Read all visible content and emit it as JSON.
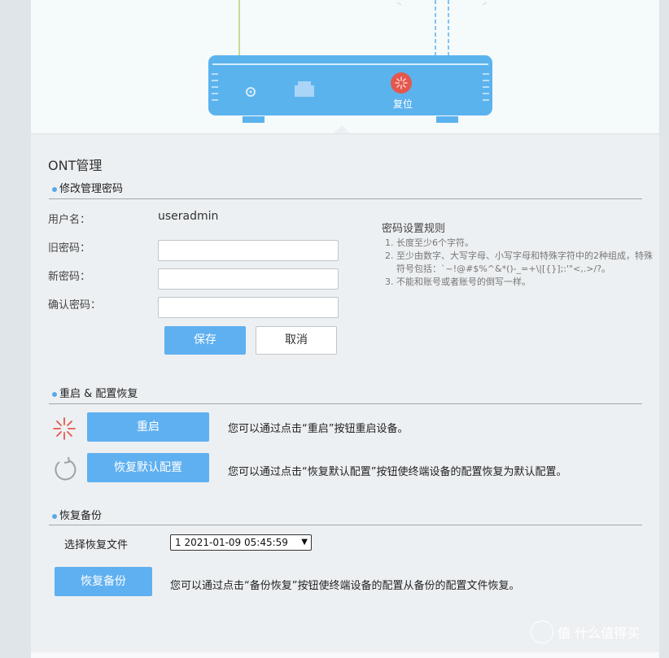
{
  "router": {
    "reset_label": "复位"
  },
  "page": {
    "title": "ONT管理"
  },
  "password_section": {
    "title": "修改管理密码",
    "username_label": "用户名：",
    "username_value": "useradmin",
    "old_password_label": "旧密码：",
    "new_password_label": "新密码：",
    "confirm_password_label": "确认密码：",
    "save_label": "保存",
    "cancel_label": "取消",
    "rules_title": "密码设置规则",
    "rules": [
      "长度至少6个字符。",
      "至少由数字、大写字母、小写字母和特殊字符中的2种组成，特殊符号包括：`~!@#$%^&*()-_=+\\|[{}];:'\"<,.>/?。",
      "不能和账号或者账号的倒写一样。"
    ]
  },
  "reboot_section": {
    "title": "重启 & 配置恢复",
    "reboot_label": "重启",
    "reboot_desc": "您可以通过点击“重启”按钮重启设备。",
    "restore_default_label": "恢复默认配置",
    "restore_default_desc": "您可以通过点击“恢复默认配置”按钮使终端设备的配置恢复为默认配置。"
  },
  "backup_section": {
    "title": "恢复备份",
    "select_file_label": "选择恢复文件",
    "selected_file": "1 2021-01-09 05:45:59",
    "restore_backup_label": "恢复备份",
    "restore_backup_desc": "您可以通过点击“备份恢复”按钮使终端设备的配置从备份的配置文件恢复。"
  },
  "watermark": {
    "text": "值 什么值得买"
  },
  "colors": {
    "accent": "#5fb0f0",
    "router_body": "#5bb3ee",
    "reset_icon": "#e4574d"
  }
}
